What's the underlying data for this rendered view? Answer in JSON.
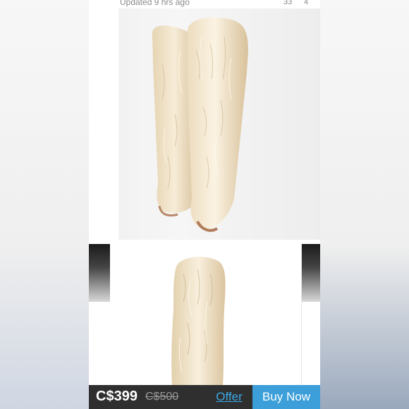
{
  "header": {
    "updated_text": "Updated 9 hrs ago",
    "likes_count": "33",
    "comments_count": "4"
  },
  "product": {
    "price": "C$399",
    "original_price": "C$500"
  },
  "actions": {
    "offer_label": "Offer",
    "buy_label": "Buy Now"
  },
  "colors": {
    "accent": "#3c9fd9",
    "bar_background": "#2f2f2f",
    "fur": "#efe2c7"
  }
}
